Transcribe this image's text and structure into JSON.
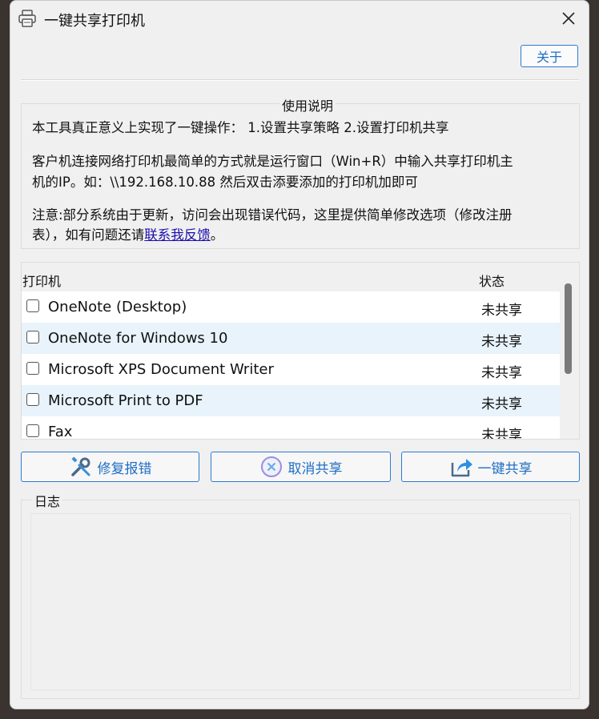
{
  "window": {
    "title": "一键共享打印机",
    "icon": "printer-icon",
    "close_icon": "close-icon"
  },
  "toolbar": {
    "about_label": "关于"
  },
  "instructions": {
    "legend": "使用说明",
    "line1": "本工具真正意义上实现了一键操作： 1.设置共享策略 2.设置打印机共享",
    "line2a": "客户机连接网络打印机最简单的方式就是运行窗口（Win+R）中输入共享打印机主",
    "line2b": "机的IP。如：\\\\192.168.10.88 然后双击添要添加的打印机加即可",
    "line3a": "注意:部分系统由于更新，访问会出现错误代码，这里提供简单修改选项（修改注册",
    "line3b_prefix": "表），如有问题还请",
    "line3b_link": "联系我反馈",
    "line3b_suffix": "。"
  },
  "printer_list": {
    "columns": [
      "打印机",
      "状态"
    ],
    "rows": [
      {
        "name": "OneNote (Desktop)",
        "status": "未共享",
        "checked": false
      },
      {
        "name": "OneNote for Windows 10",
        "status": "未共享",
        "checked": false
      },
      {
        "name": "Microsoft XPS Document Writer",
        "status": "未共享",
        "checked": false
      },
      {
        "name": "Microsoft Print to PDF",
        "status": "未共享",
        "checked": false
      },
      {
        "name": "Fax",
        "status": "未共享",
        "checked": false
      }
    ]
  },
  "actions": {
    "repair_label": "修复报错",
    "cancel_label": "取消共享",
    "share_label": "一键共享",
    "repair_icon": "wrench-screwdriver-icon",
    "cancel_icon": "cancel-circle-icon",
    "share_icon": "share-arrow-icon"
  },
  "log": {
    "legend": "日志",
    "content": ""
  },
  "colors": {
    "accent": "#2b7ccf",
    "link": "#1a0dab",
    "row_alt": "#e8f3fb"
  }
}
